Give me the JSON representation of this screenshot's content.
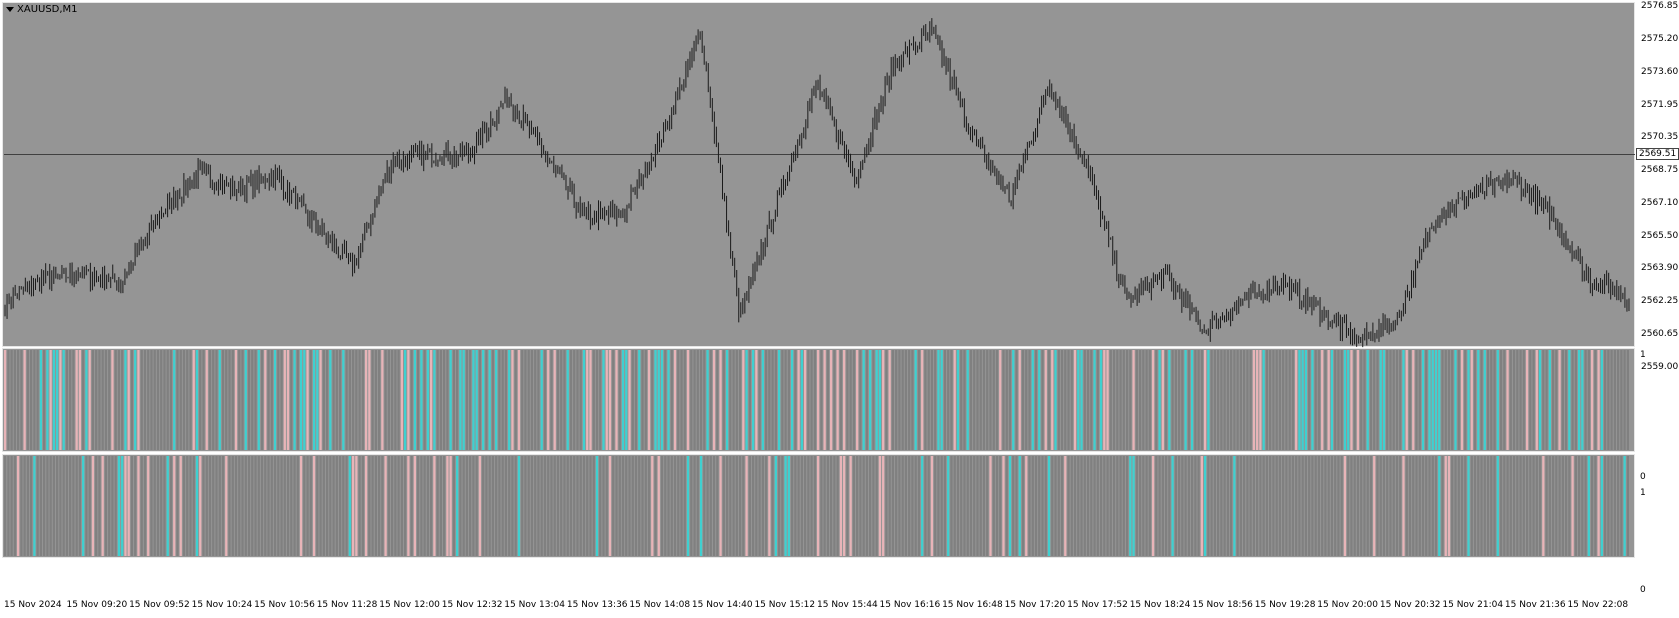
{
  "window": {
    "symbol_label": "XAUUSD,M1"
  },
  "price_axis": {
    "ticks": [
      "2576.85",
      "2575.20",
      "2573.60",
      "2571.95",
      "2570.35",
      "2568.75",
      "2567.10",
      "2565.50",
      "2563.90",
      "2562.25",
      "2560.65",
      "2559.00"
    ],
    "current_price_label": "2569.51"
  },
  "indicator_axis_1": {
    "top": "1",
    "bottom": "0"
  },
  "indicator_axis_2": {
    "top": "1",
    "bottom": "0"
  },
  "time_axis": {
    "labels": [
      "15 Nov 2024",
      "15 Nov 09:20",
      "15 Nov 09:52",
      "15 Nov 10:24",
      "15 Nov 10:56",
      "15 Nov 11:28",
      "15 Nov 12:00",
      "15 Nov 12:32",
      "15 Nov 13:04",
      "15 Nov 13:36",
      "15 Nov 14:08",
      "15 Nov 14:40",
      "15 Nov 15:12",
      "15 Nov 15:44",
      "15 Nov 16:16",
      "15 Nov 16:48",
      "15 Nov 17:20",
      "15 Nov 17:52",
      "15 Nov 18:24",
      "15 Nov 18:56",
      "15 Nov 19:28",
      "15 Nov 20:00",
      "15 Nov 20:32",
      "15 Nov 21:04",
      "15 Nov 21:36",
      "15 Nov 22:08"
    ]
  },
  "colors": {
    "background": "#959595",
    "bars": "#1a1a1a",
    "cyan": "#3fd0d0",
    "pink": "#e8b4b8",
    "gray_bar": "#808080",
    "price_line": "#404040"
  },
  "chart_data": [
    {
      "type": "line",
      "title": "XAUUSD,M1",
      "ylim": [
        2559.0,
        2576.85
      ],
      "current_price": 2569.51,
      "x": [
        "15 Nov 2024",
        "15 Nov 09:20",
        "15 Nov 09:52",
        "15 Nov 10:24",
        "15 Nov 10:56",
        "15 Nov 11:28",
        "15 Nov 12:00",
        "15 Nov 12:32",
        "15 Nov 13:04",
        "15 Nov 13:36",
        "15 Nov 14:08",
        "15 Nov 14:40",
        "15 Nov 15:12",
        "15 Nov 15:44",
        "15 Nov 16:16",
        "15 Nov 16:48",
        "15 Nov 17:20",
        "15 Nov 17:52",
        "15 Nov 18:24",
        "15 Nov 18:56",
        "15 Nov 19:28",
        "15 Nov 20:00",
        "15 Nov 20:32",
        "15 Nov 21:04",
        "15 Nov 21:36",
        "15 Nov 22:08"
      ],
      "series": [
        {
          "values": [
            2562.2,
            2563.4,
            2563.6,
            2563.2,
            2566.5,
            2568.6,
            2567.8,
            2568.5,
            2566.0,
            2564.0,
            2569.2,
            2569.5,
            2569.5,
            2572.4,
            2569.4,
            2566.4,
            2566.6,
            2570.5,
            2575.5,
            2561.5,
            2567.3,
            2573.0,
            2568.4,
            2574.0,
            2575.6,
            2570.5,
            2567.3,
            2573.0,
            2568.8,
            2562.3,
            2563.6,
            2560.8,
            2562.2,
            2563.2,
            2561.8,
            2560.3,
            2561.3,
            2566.5,
            2567.6,
            2568.3,
            2566.5,
            2563.3,
            2562.5
          ]
        }
      ]
    },
    {
      "type": "bar",
      "ylim": [
        0,
        1
      ]
    },
    {
      "type": "bar",
      "ylim": [
        0,
        1
      ]
    }
  ]
}
